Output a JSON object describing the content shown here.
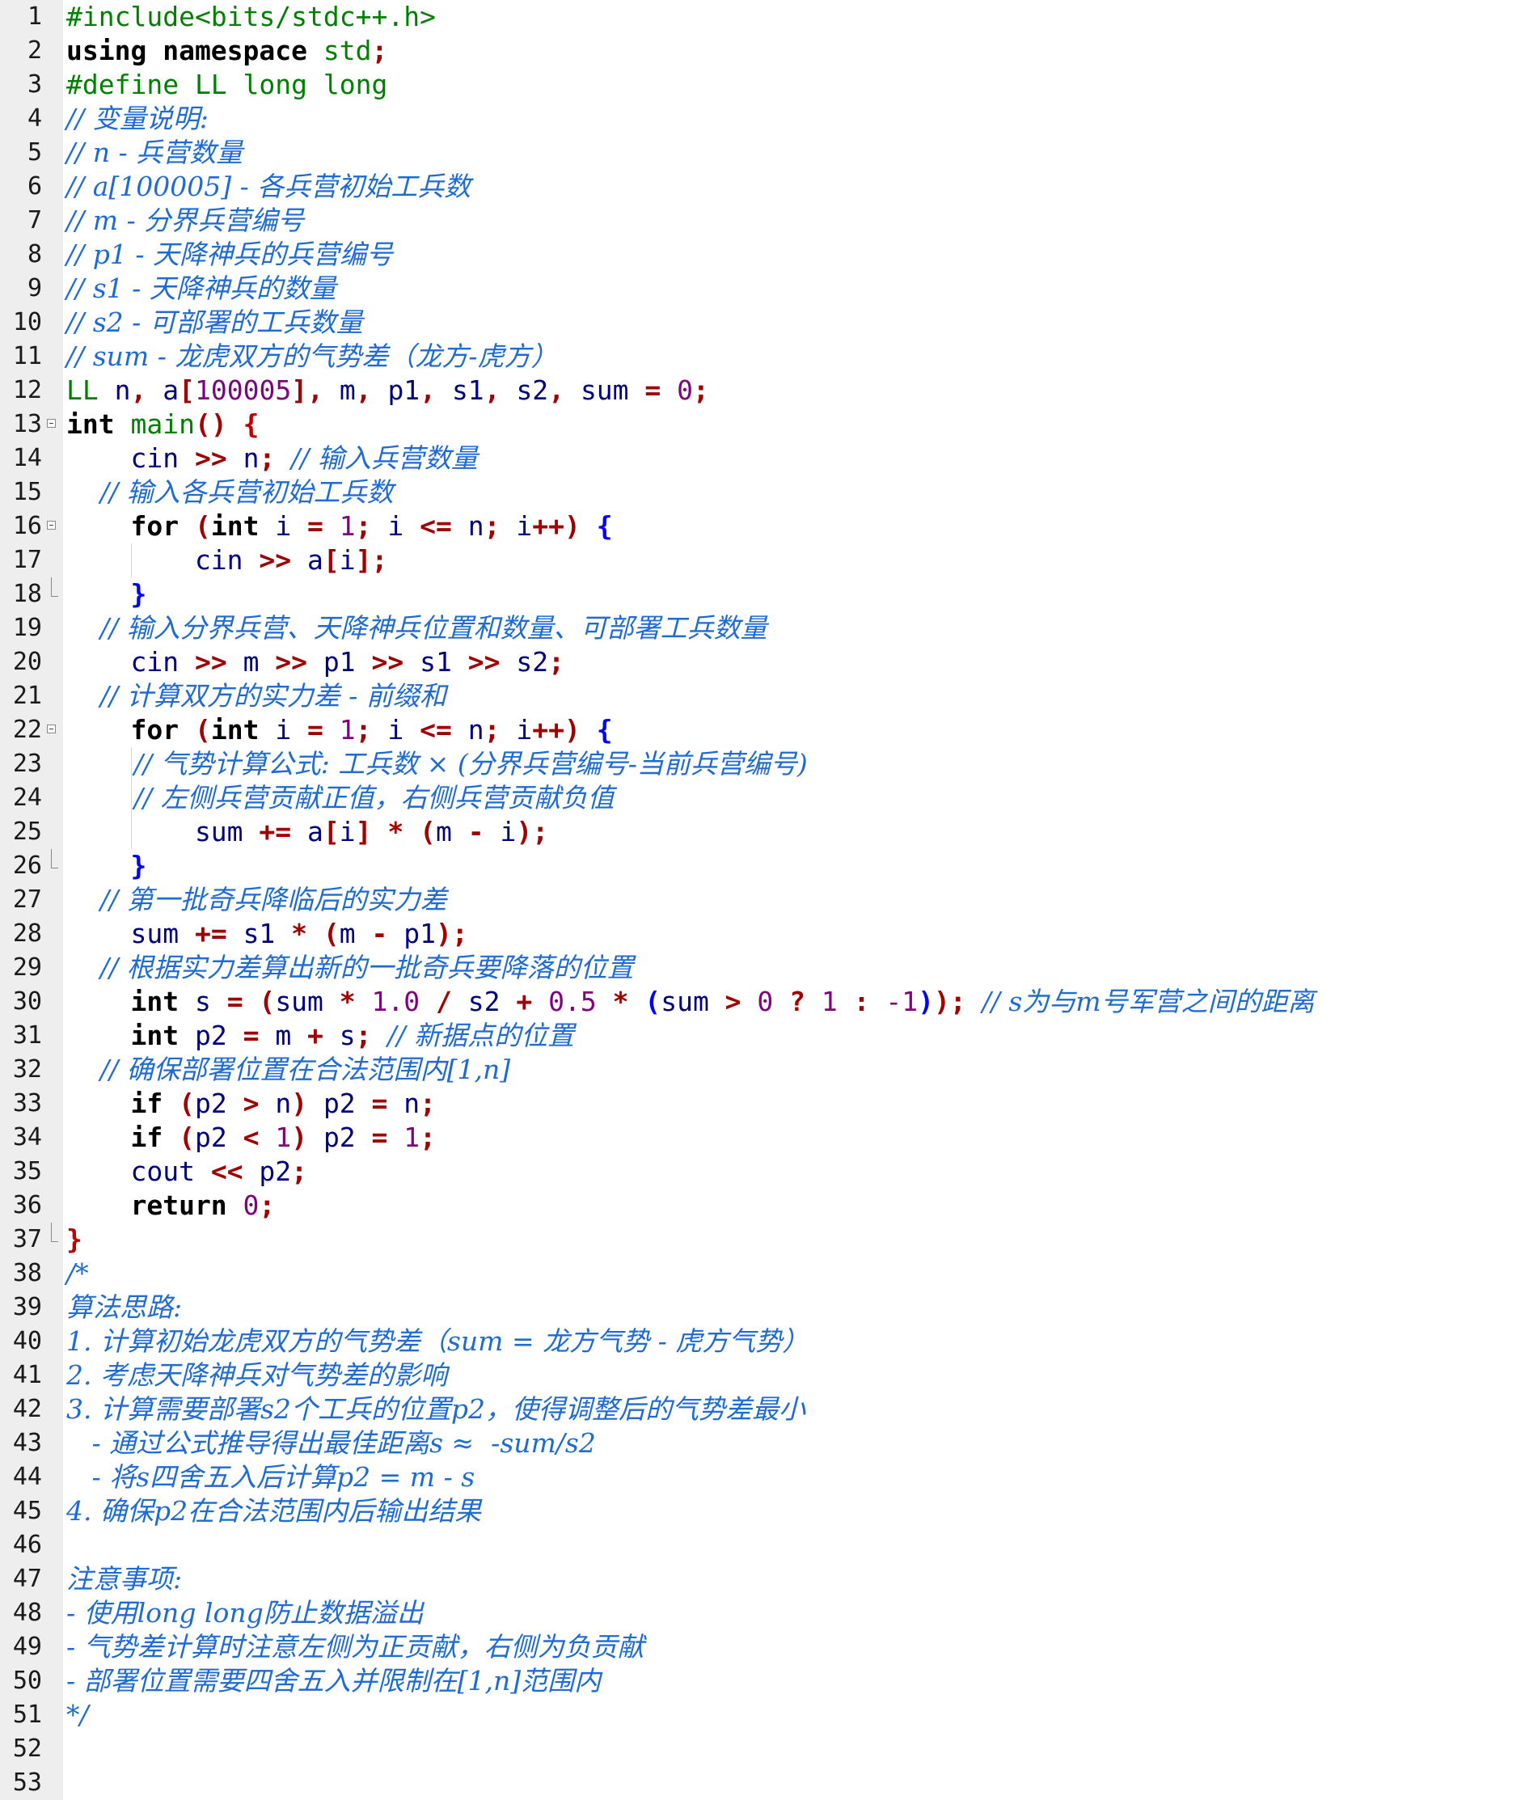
{
  "editor": {
    "lines": [
      {
        "n": "1",
        "tokens": [
          {
            "t": "#include<bits/stdc++.h>",
            "c": "pp"
          }
        ]
      },
      {
        "n": "2",
        "tokens": [
          {
            "t": "using namespace ",
            "c": "kw"
          },
          {
            "t": "std",
            "c": "pp"
          },
          {
            "t": ";",
            "c": "op"
          }
        ]
      },
      {
        "n": "3",
        "tokens": [
          {
            "t": "#define LL long long",
            "c": "pp"
          }
        ]
      },
      {
        "n": "4",
        "tokens": [
          {
            "t": "// 变量说明:",
            "c": "cm"
          }
        ]
      },
      {
        "n": "5",
        "tokens": [
          {
            "t": "// n - 兵营数量",
            "c": "cm"
          }
        ]
      },
      {
        "n": "6",
        "tokens": [
          {
            "t": "// a[100005] - 各兵营初始工兵数",
            "c": "cm"
          }
        ]
      },
      {
        "n": "7",
        "tokens": [
          {
            "t": "// m - 分界兵营编号",
            "c": "cm"
          }
        ]
      },
      {
        "n": "8",
        "tokens": [
          {
            "t": "// p1 - 天降神兵的兵营编号",
            "c": "cm"
          }
        ]
      },
      {
        "n": "9",
        "tokens": [
          {
            "t": "// s1 - 天降神兵的数量",
            "c": "cm"
          }
        ]
      },
      {
        "n": "10",
        "tokens": [
          {
            "t": "// s2 - 可部署的工兵数量",
            "c": "cm"
          }
        ]
      },
      {
        "n": "11",
        "tokens": [
          {
            "t": "// sum - 龙虎双方的气势差（龙方-虎方）",
            "c": "cm"
          }
        ]
      },
      {
        "n": "12",
        "tokens": [
          {
            "t": "LL ",
            "c": "ty"
          },
          {
            "t": "n",
            "c": "id"
          },
          {
            "t": ", ",
            "c": "op"
          },
          {
            "t": "a",
            "c": "id"
          },
          {
            "t": "[",
            "c": "op"
          },
          {
            "t": "100005",
            "c": "nm"
          },
          {
            "t": "], ",
            "c": "op"
          },
          {
            "t": "m",
            "c": "id"
          },
          {
            "t": ", ",
            "c": "op"
          },
          {
            "t": "p1",
            "c": "id"
          },
          {
            "t": ", ",
            "c": "op"
          },
          {
            "t": "s1",
            "c": "id"
          },
          {
            "t": ", ",
            "c": "op"
          },
          {
            "t": "s2",
            "c": "id"
          },
          {
            "t": ", ",
            "c": "op"
          },
          {
            "t": "sum",
            "c": "id"
          },
          {
            "t": " = ",
            "c": "op"
          },
          {
            "t": "0",
            "c": "nm"
          },
          {
            "t": ";",
            "c": "op"
          }
        ]
      },
      {
        "n": "13",
        "fold": "open",
        "tokens": [
          {
            "t": "int ",
            "c": "kw"
          },
          {
            "t": "main",
            "c": "fn"
          },
          {
            "t": "() ",
            "c": "op"
          },
          {
            "t": "{",
            "c": "red"
          }
        ]
      },
      {
        "n": "14",
        "tokens": [
          {
            "t": "    cin ",
            "c": "id"
          },
          {
            "t": ">> ",
            "c": "op"
          },
          {
            "t": "n",
            "c": "id"
          },
          {
            "t": "; ",
            "c": "op"
          },
          {
            "t": "// 输入兵营数量",
            "c": "cm"
          }
        ]
      },
      {
        "n": "15",
        "tokens": [
          {
            "t": "    // 输入各兵营初始工兵数",
            "c": "cm"
          }
        ]
      },
      {
        "n": "16",
        "fold": "open",
        "tokens": [
          {
            "t": "    for ",
            "c": "kw"
          },
          {
            "t": "(",
            "c": "op"
          },
          {
            "t": "int ",
            "c": "kw"
          },
          {
            "t": "i",
            "c": "id"
          },
          {
            "t": " = ",
            "c": "op"
          },
          {
            "t": "1",
            "c": "nm"
          },
          {
            "t": "; ",
            "c": "op"
          },
          {
            "t": "i",
            "c": "id"
          },
          {
            "t": " <= ",
            "c": "op"
          },
          {
            "t": "n",
            "c": "id"
          },
          {
            "t": "; ",
            "c": "op"
          },
          {
            "t": "i",
            "c": "id"
          },
          {
            "t": "++) ",
            "c": "op"
          },
          {
            "t": "{",
            "c": "br"
          }
        ]
      },
      {
        "n": "17",
        "tokens": [
          {
            "t": "        cin ",
            "c": "id"
          },
          {
            "t": ">> ",
            "c": "op"
          },
          {
            "t": "a",
            "c": "id"
          },
          {
            "t": "[",
            "c": "op"
          },
          {
            "t": "i",
            "c": "id"
          },
          {
            "t": "];",
            "c": "op"
          }
        ]
      },
      {
        "n": "18",
        "fold": "end",
        "tokens": [
          {
            "t": "    ",
            "c": "tx"
          },
          {
            "t": "}",
            "c": "br"
          }
        ]
      },
      {
        "n": "19",
        "tokens": [
          {
            "t": "    // 输入分界兵营、天降神兵位置和数量、可部署工兵数量",
            "c": "cm"
          }
        ]
      },
      {
        "n": "20",
        "tokens": [
          {
            "t": "    cin ",
            "c": "id"
          },
          {
            "t": ">> ",
            "c": "op"
          },
          {
            "t": "m",
            "c": "id"
          },
          {
            "t": " >> ",
            "c": "op"
          },
          {
            "t": "p1",
            "c": "id"
          },
          {
            "t": " >> ",
            "c": "op"
          },
          {
            "t": "s1",
            "c": "id"
          },
          {
            "t": " >> ",
            "c": "op"
          },
          {
            "t": "s2",
            "c": "id"
          },
          {
            "t": ";",
            "c": "op"
          }
        ]
      },
      {
        "n": "21",
        "tokens": [
          {
            "t": "    // 计算双方的实力差 - 前缀和",
            "c": "cm"
          }
        ]
      },
      {
        "n": "22",
        "fold": "open",
        "tokens": [
          {
            "t": "    for ",
            "c": "kw"
          },
          {
            "t": "(",
            "c": "op"
          },
          {
            "t": "int ",
            "c": "kw"
          },
          {
            "t": "i",
            "c": "id"
          },
          {
            "t": " = ",
            "c": "op"
          },
          {
            "t": "1",
            "c": "nm"
          },
          {
            "t": "; ",
            "c": "op"
          },
          {
            "t": "i",
            "c": "id"
          },
          {
            "t": " <= ",
            "c": "op"
          },
          {
            "t": "n",
            "c": "id"
          },
          {
            "t": "; ",
            "c": "op"
          },
          {
            "t": "i",
            "c": "id"
          },
          {
            "t": "++) ",
            "c": "op"
          },
          {
            "t": "{",
            "c": "br"
          }
        ]
      },
      {
        "n": "23",
        "tokens": [
          {
            "t": "        // 气势计算公式: 工兵数 × (分界兵营编号-当前兵营编号)",
            "c": "cm"
          }
        ]
      },
      {
        "n": "24",
        "tokens": [
          {
            "t": "        // 左侧兵营贡献正值，右侧兵营贡献负值",
            "c": "cm"
          }
        ]
      },
      {
        "n": "25",
        "tokens": [
          {
            "t": "        sum ",
            "c": "id"
          },
          {
            "t": "+= ",
            "c": "op"
          },
          {
            "t": "a",
            "c": "id"
          },
          {
            "t": "[",
            "c": "op"
          },
          {
            "t": "i",
            "c": "id"
          },
          {
            "t": "] * (",
            "c": "op"
          },
          {
            "t": "m",
            "c": "id"
          },
          {
            "t": " - ",
            "c": "op"
          },
          {
            "t": "i",
            "c": "id"
          },
          {
            "t": ");",
            "c": "op"
          }
        ]
      },
      {
        "n": "26",
        "fold": "end",
        "tokens": [
          {
            "t": "    ",
            "c": "tx"
          },
          {
            "t": "}",
            "c": "br"
          }
        ]
      },
      {
        "n": "27",
        "tokens": [
          {
            "t": "    // 第一批奇兵降临后的实力差",
            "c": "cm"
          }
        ]
      },
      {
        "n": "28",
        "tokens": [
          {
            "t": "    sum ",
            "c": "id"
          },
          {
            "t": "+= ",
            "c": "op"
          },
          {
            "t": "s1",
            "c": "id"
          },
          {
            "t": " * (",
            "c": "op"
          },
          {
            "t": "m",
            "c": "id"
          },
          {
            "t": " - ",
            "c": "op"
          },
          {
            "t": "p1",
            "c": "id"
          },
          {
            "t": ");",
            "c": "op"
          }
        ]
      },
      {
        "n": "29",
        "tokens": [
          {
            "t": "    // 根据实力差算出新的一批奇兵要降落的位置",
            "c": "cm"
          }
        ]
      },
      {
        "n": "30",
        "tokens": [
          {
            "t": "    int ",
            "c": "kw"
          },
          {
            "t": "s",
            "c": "id"
          },
          {
            "t": " = (",
            "c": "op"
          },
          {
            "t": "sum",
            "c": "id"
          },
          {
            "t": " * ",
            "c": "op"
          },
          {
            "t": "1.0",
            "c": "nm"
          },
          {
            "t": " / ",
            "c": "op"
          },
          {
            "t": "s2",
            "c": "id"
          },
          {
            "t": " + ",
            "c": "op"
          },
          {
            "t": "0.5",
            "c": "nm"
          },
          {
            "t": " * ",
            "c": "op"
          },
          {
            "t": "(",
            "c": "br"
          },
          {
            "t": "sum",
            "c": "id"
          },
          {
            "t": " > ",
            "c": "op"
          },
          {
            "t": "0",
            "c": "nm"
          },
          {
            "t": " ? ",
            "c": "op"
          },
          {
            "t": "1",
            "c": "nm"
          },
          {
            "t": " : ",
            "c": "op"
          },
          {
            "t": "-1",
            "c": "nm"
          },
          {
            "t": ")",
            "c": "br"
          },
          {
            "t": "); ",
            "c": "op"
          },
          {
            "t": "// s为与m号军营之间的距离",
            "c": "cm"
          }
        ]
      },
      {
        "n": "31",
        "tokens": [
          {
            "t": "    int ",
            "c": "kw"
          },
          {
            "t": "p2",
            "c": "id"
          },
          {
            "t": " = ",
            "c": "op"
          },
          {
            "t": "m",
            "c": "id"
          },
          {
            "t": " + ",
            "c": "op"
          },
          {
            "t": "s",
            "c": "id"
          },
          {
            "t": "; ",
            "c": "op"
          },
          {
            "t": "// 新据点的位置",
            "c": "cm"
          }
        ]
      },
      {
        "n": "32",
        "tokens": [
          {
            "t": "    // 确保部署位置在合法范围内[1,n]",
            "c": "cm"
          }
        ]
      },
      {
        "n": "33",
        "tokens": [
          {
            "t": "    if ",
            "c": "kw"
          },
          {
            "t": "(",
            "c": "op"
          },
          {
            "t": "p2",
            "c": "id"
          },
          {
            "t": " > ",
            "c": "op"
          },
          {
            "t": "n",
            "c": "id"
          },
          {
            "t": ") ",
            "c": "op"
          },
          {
            "t": "p2",
            "c": "id"
          },
          {
            "t": " = ",
            "c": "op"
          },
          {
            "t": "n",
            "c": "id"
          },
          {
            "t": ";",
            "c": "op"
          }
        ]
      },
      {
        "n": "34",
        "tokens": [
          {
            "t": "    if ",
            "c": "kw"
          },
          {
            "t": "(",
            "c": "op"
          },
          {
            "t": "p2",
            "c": "id"
          },
          {
            "t": " < ",
            "c": "op"
          },
          {
            "t": "1",
            "c": "nm"
          },
          {
            "t": ") ",
            "c": "op"
          },
          {
            "t": "p2",
            "c": "id"
          },
          {
            "t": " = ",
            "c": "op"
          },
          {
            "t": "1",
            "c": "nm"
          },
          {
            "t": ";",
            "c": "op"
          }
        ]
      },
      {
        "n": "35",
        "tokens": [
          {
            "t": "    cout ",
            "c": "id"
          },
          {
            "t": "<< ",
            "c": "op"
          },
          {
            "t": "p2",
            "c": "id"
          },
          {
            "t": ";",
            "c": "op"
          }
        ]
      },
      {
        "n": "36",
        "tokens": [
          {
            "t": "    return ",
            "c": "kw"
          },
          {
            "t": "0",
            "c": "nm"
          },
          {
            "t": ";",
            "c": "op"
          }
        ]
      },
      {
        "n": "37",
        "fold": "end",
        "tokens": [
          {
            "t": "}",
            "c": "red"
          }
        ]
      },
      {
        "n": "38",
        "tokens": [
          {
            "t": "/*",
            "c": "cm"
          }
        ]
      },
      {
        "n": "39",
        "tokens": [
          {
            "t": "算法思路:",
            "c": "cm"
          }
        ]
      },
      {
        "n": "40",
        "tokens": [
          {
            "t": "1. 计算初始龙虎双方的气势差（sum = 龙方气势 - 虎方气势）",
            "c": "cm"
          }
        ]
      },
      {
        "n": "41",
        "tokens": [
          {
            "t": "2. 考虑天降神兵对气势差的影响",
            "c": "cm"
          }
        ]
      },
      {
        "n": "42",
        "tokens": [
          {
            "t": "3. 计算需要部署s2个工兵的位置p2，使得调整后的气势差最小",
            "c": "cm"
          }
        ]
      },
      {
        "n": "43",
        "tokens": [
          {
            "t": "   - 通过公式推导得出最佳距离s ≈  -sum/s2",
            "c": "cm"
          }
        ]
      },
      {
        "n": "44",
        "tokens": [
          {
            "t": "   - 将s四舍五入后计算p2 = m - s",
            "c": "cm"
          }
        ]
      },
      {
        "n": "45",
        "tokens": [
          {
            "t": "4. 确保p2在合法范围内后输出结果",
            "c": "cm"
          }
        ]
      },
      {
        "n": "46",
        "tokens": []
      },
      {
        "n": "47",
        "tokens": [
          {
            "t": "注意事项:",
            "c": "cm"
          }
        ]
      },
      {
        "n": "48",
        "tokens": [
          {
            "t": "- 使用long long防止数据溢出",
            "c": "cm"
          }
        ]
      },
      {
        "n": "49",
        "tokens": [
          {
            "t": "- 气势差计算时注意左侧为正贡献，右侧为负贡献",
            "c": "cm"
          }
        ]
      },
      {
        "n": "50",
        "tokens": [
          {
            "t": "- 部署位置需要四舍五入并限制在[1,n]范围内",
            "c": "cm"
          }
        ]
      },
      {
        "n": "51",
        "tokens": [
          {
            "t": "*/",
            "c": "cm"
          }
        ]
      },
      {
        "n": "52",
        "tokens": []
      },
      {
        "n": "53",
        "tokens": []
      }
    ]
  },
  "colors": {
    "preprocessor": "#008000",
    "keyword": "#000000",
    "comment": "#1e6bd6",
    "number": "#800080",
    "operator": "#a00000",
    "brace": "#0000ff",
    "gutter_bg": "#eeeeee"
  }
}
